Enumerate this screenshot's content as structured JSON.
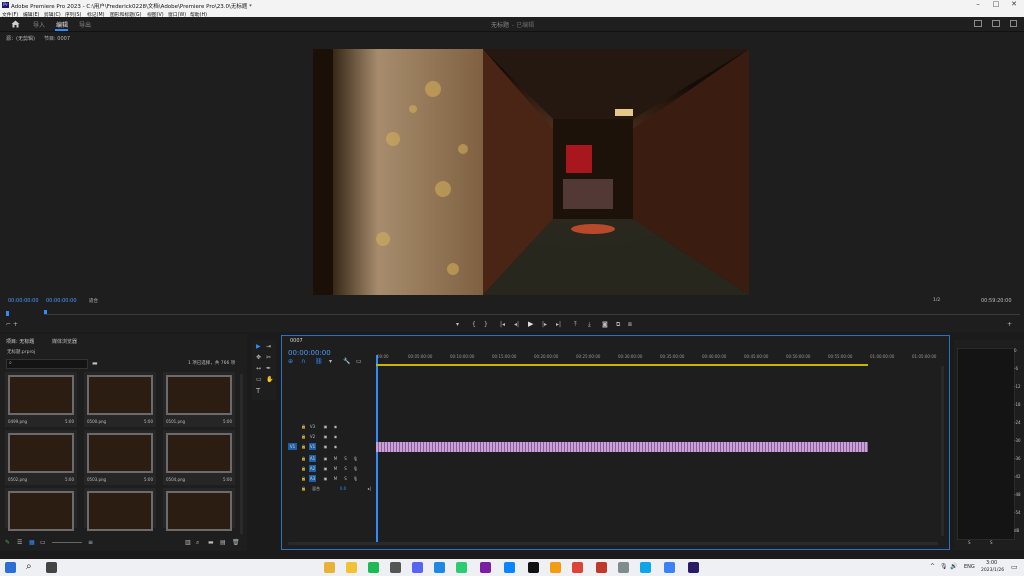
{
  "titlebar": {
    "logo": "Pr",
    "title": "Adobe Premiere Pro 2023 - C:\\用户\\Frederick0228\\文档\\Adobe\\Premiere Pro\\23.0\\无标题 *"
  },
  "menu": [
    "文件(F)",
    "编辑(E)",
    "剪辑(C)",
    "序列(S)",
    "标记(M)",
    "图形和标题(G)",
    "视图(V)",
    "窗口(W)",
    "帮助(H)"
  ],
  "header": {
    "tabs": [
      "导入",
      "编辑",
      "导出"
    ],
    "active_tab": "编辑",
    "project_title": "无标题",
    "project_status": "- 已编辑"
  },
  "source_panel": {
    "label": "源：(无剪辑)"
  },
  "program_monitor": {
    "label": "节目: 0007",
    "timecode_left": "00:00:00:00",
    "timecode_center": "00:00:00:00",
    "fit": "适合",
    "quality": "1/2",
    "duration": "00:59:20:00"
  },
  "project_panel": {
    "tabs": [
      "项目: 无标题",
      "媒体浏览器"
    ],
    "file": "无标题.prproj",
    "selection": "1 项已选择，共 766 项",
    "clips": [
      {
        "name": "0499.png",
        "duration": "5:00"
      },
      {
        "name": "0500.png",
        "duration": "5:00"
      },
      {
        "name": "0501.png",
        "duration": "5:00"
      },
      {
        "name": "0502.png",
        "duration": "5:00"
      },
      {
        "name": "0503.png",
        "duration": "5:00"
      },
      {
        "name": "0504.png",
        "duration": "5:00"
      },
      {
        "name": "",
        "duration": ""
      },
      {
        "name": "",
        "duration": ""
      },
      {
        "name": "",
        "duration": ""
      }
    ]
  },
  "timeline": {
    "sequence_tab": "0007",
    "timecode": "00:00:00:00",
    "ruler": [
      "00:00",
      "00:05:00:00",
      "00:10:00:00",
      "00:15:00:00",
      "00:20:00:00",
      "00:25:00:00",
      "00:30:00:00",
      "00:35:00:00",
      "00:40:00:00",
      "00:45:00:00",
      "00:50:00:00",
      "00:55:00:00",
      "01:00:00:00",
      "01:05:00:00"
    ],
    "video_tracks": [
      "V3",
      "V2",
      "V1"
    ],
    "audio_tracks": [
      "A1",
      "A2",
      "A3"
    ],
    "mix_label": "混合",
    "mix_value": "0.0"
  },
  "meter": {
    "scale": [
      "0",
      "-6",
      "-12",
      "-18",
      "-24",
      "-30",
      "-36",
      "-42",
      "-48",
      "-54",
      "dB"
    ],
    "channels": [
      "S",
      "S"
    ]
  },
  "taskbar": {
    "lang": "ENG",
    "time": "3:00",
    "date": "2023/1/26"
  },
  "colors": {
    "accent": "#2d8cff",
    "clip": "#c9a1d6",
    "ruler_bar": "#c9b400"
  }
}
